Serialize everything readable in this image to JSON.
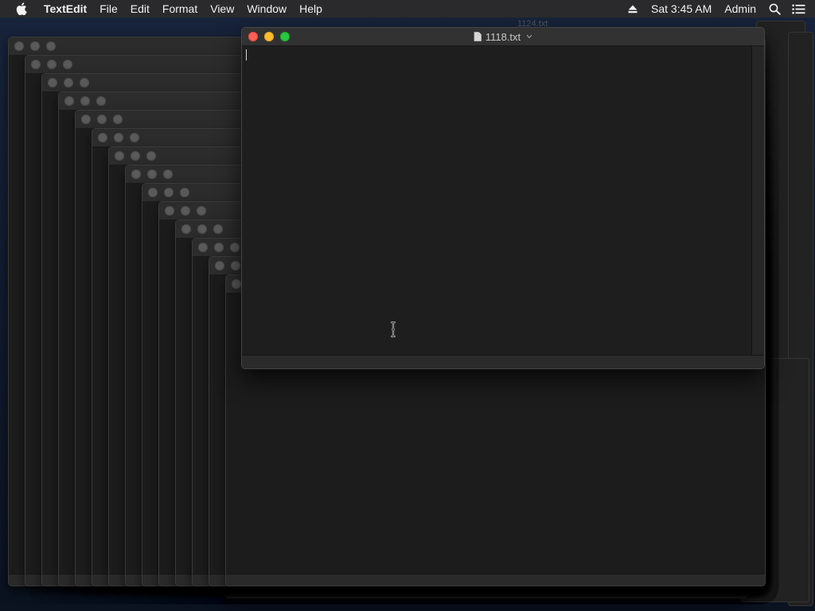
{
  "menubar": {
    "app_name": "TextEdit",
    "menus": [
      "File",
      "Edit",
      "Format",
      "View",
      "Window",
      "Help"
    ],
    "clock": "Sat 3:45 AM",
    "user": "Admin",
    "icons": {
      "apple": "apple-icon",
      "eject": "eject-icon",
      "spotlight": "search-icon",
      "notification": "notification-center-icon"
    }
  },
  "front_window": {
    "title": "1118.txt",
    "document_text": ""
  },
  "ghost_title": "1124.txt",
  "colors": {
    "close": "#fc5f57",
    "minimize": "#fdbc2e",
    "zoom": "#28c840",
    "inactive_light": "#5a5a5a"
  }
}
